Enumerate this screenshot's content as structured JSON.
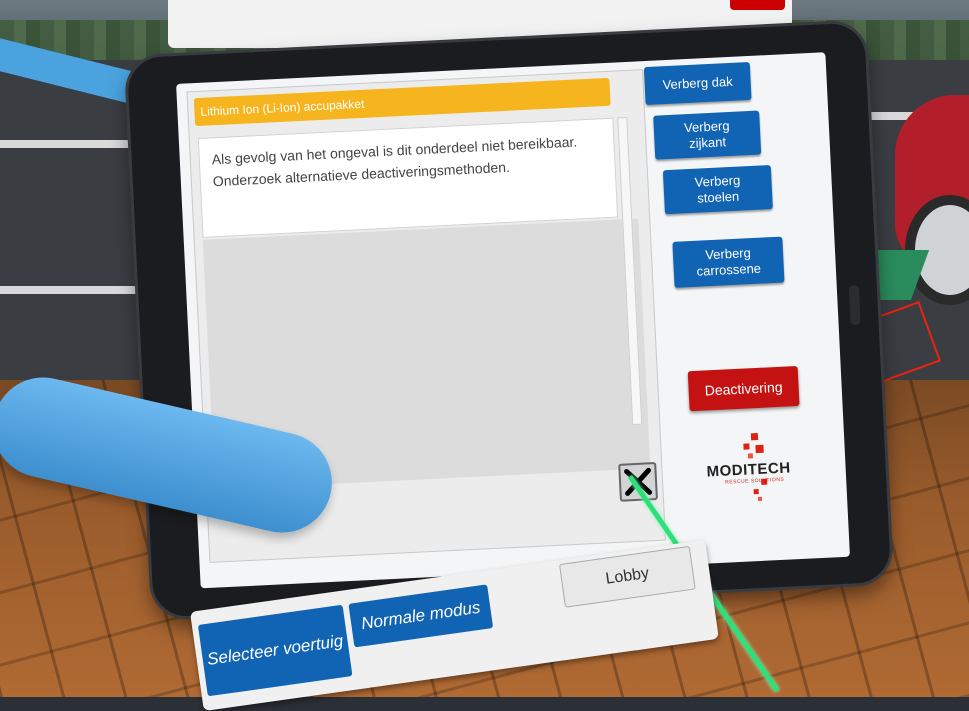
{
  "panel": {
    "title": "Lithium Ion (Li-Ion) accupakket",
    "message": "Als gevolg van het ongeval is dit onderdeel niet bereikbaar. Onderzoek alternatieve deactiveringsmethoden."
  },
  "side_buttons": {
    "hide_roof": "Verberg dak",
    "hide_side": "Verberg zijkant",
    "hide_seats": "Verberg stoelen",
    "hide_body": "Verberg carrossene",
    "deactivate": "Deactivering"
  },
  "logo": {
    "text": "MODITECH",
    "tagline": "RESCUE SOLUTIONS"
  },
  "menu": {
    "select_vehicle": "Selecteer voertuig",
    "normal_mode": "Normale modus",
    "lobby": "Lobby"
  },
  "colors": {
    "title_bar": "#f6b51e",
    "button_blue": "#1163b3",
    "deactivate_red": "#c41212",
    "pointer_green": "#2ee07a"
  },
  "icons": {
    "close": "close-x-icon"
  }
}
